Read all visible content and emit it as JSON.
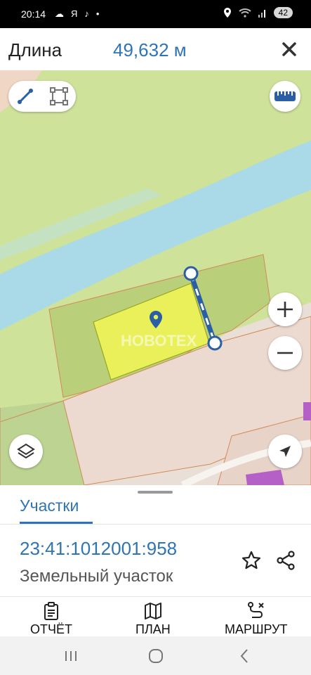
{
  "status_bar": {
    "time": "20:14",
    "left_icons": [
      "cloud-icon",
      "ya-icon",
      "tiktok-icon",
      "dot-icon"
    ],
    "left_text": [
      "☁",
      "Я",
      "♪",
      "•"
    ],
    "right_icons": [
      "location-icon",
      "wifi-icon",
      "signal-icon",
      "battery-icon"
    ],
    "battery": "42"
  },
  "measure": {
    "label": "Длина",
    "value": "49,632 м"
  },
  "map": {
    "watermark": "НОВОТЕХ",
    "colors": {
      "vegetation": "#cfe29a",
      "river": "#aad9e8",
      "parcel_fill": "#e9f05a",
      "urban": "#eadfd6",
      "parcel_border": "#d28a5a",
      "measure_line": "#2a5fa5",
      "building": "#b560c7"
    }
  },
  "sheet": {
    "tab_label": "Участки",
    "cadastral_number": "23:41:1012001:958",
    "parcel_type": "Земельный участок"
  },
  "actions": [
    {
      "label": "ОТЧЁТ",
      "icon": "clipboard-icon"
    },
    {
      "label": "ПЛАН",
      "icon": "map-icon"
    },
    {
      "label": "МАРШРУТ",
      "icon": "route-icon"
    }
  ]
}
